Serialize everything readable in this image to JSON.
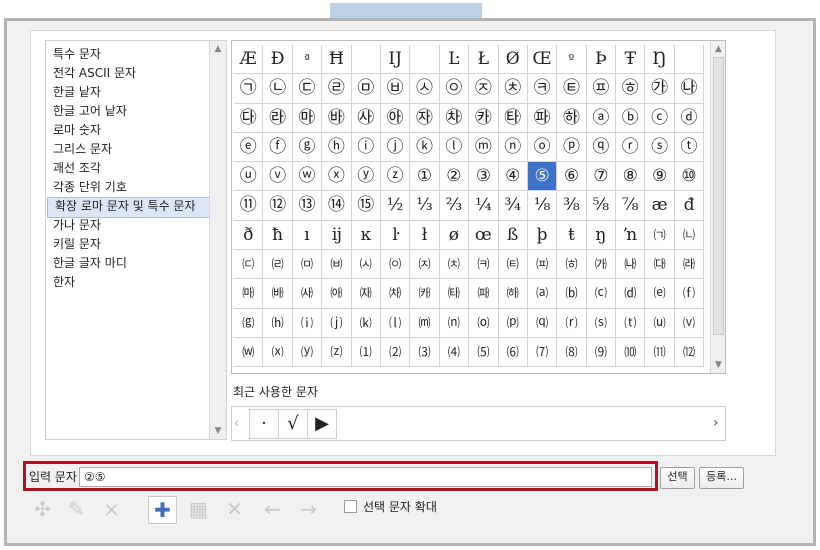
{
  "categories": [
    "특수 문자",
    "전각 ASCII 문자",
    "한글 낱자",
    "한글 고어 낱자",
    "로마 숫자",
    "그리스 문자",
    "괘선 조각",
    "각종 단위 기호",
    "확장 로마 문자 및 특수 문자",
    "가나 문자",
    "키릴 문자",
    "한글 글자 마디",
    "한자"
  ],
  "selected_category": "확장 로마 문자 및 특수 문자",
  "grid_rows": [
    [
      "Æ",
      "Ð",
      "ª",
      "Ħ",
      "",
      "Ĳ",
      "",
      "Ŀ",
      "Ł",
      "Ø",
      "Œ",
      "º",
      "Þ",
      "Ŧ",
      "Ŋ",
      ""
    ],
    [
      "㉠",
      "㉡",
      "㉢",
      "㉣",
      "㉤",
      "㉥",
      "㉦",
      "㉧",
      "㉨",
      "㉩",
      "㉪",
      "㉫",
      "㉬",
      "㉭",
      "㉮",
      "㉯"
    ],
    [
      "㉰",
      "㉱",
      "㉲",
      "㉳",
      "㉴",
      "㉵",
      "㉶",
      "㉷",
      "㉸",
      "㉹",
      "㉺",
      "㉻",
      "ⓐ",
      "ⓑ",
      "ⓒ",
      "ⓓ"
    ],
    [
      "ⓔ",
      "ⓕ",
      "ⓖ",
      "ⓗ",
      "ⓘ",
      "ⓙ",
      "ⓚ",
      "ⓛ",
      "ⓜ",
      "ⓝ",
      "ⓞ",
      "ⓟ",
      "ⓠ",
      "ⓡ",
      "ⓢ",
      "ⓣ"
    ],
    [
      "ⓤ",
      "ⓥ",
      "ⓦ",
      "ⓧ",
      "ⓨ",
      "ⓩ",
      "①",
      "②",
      "③",
      "④",
      "⑤",
      "⑥",
      "⑦",
      "⑧",
      "⑨",
      "⑩"
    ],
    [
      "⑪",
      "⑫",
      "⑬",
      "⑭",
      "⑮",
      "½",
      "⅓",
      "⅔",
      "¼",
      "¾",
      "⅛",
      "⅜",
      "⅝",
      "⅞",
      "æ",
      "đ"
    ],
    [
      "ð",
      "ħ",
      "ı",
      "ĳ",
      "ĸ",
      "ŀ",
      "ł",
      "ø",
      "œ",
      "ß",
      "þ",
      "ŧ",
      "ŋ",
      "ŉ",
      "㈀",
      "㈁"
    ],
    [
      "㈂",
      "㈃",
      "㈄",
      "㈅",
      "㈆",
      "㈇",
      "㈈",
      "㈉",
      "㈊",
      "㈋",
      "㈌",
      "㈍",
      "㈎",
      "㈏",
      "㈐",
      "㈑"
    ],
    [
      "㈒",
      "㈓",
      "㈔",
      "㈕",
      "㈖",
      "㈗",
      "㈘",
      "㈙",
      "㈚",
      "㈛",
      "⒜",
      "⒝",
      "⒞",
      "⒟",
      "⒠",
      "⒡"
    ],
    [
      "⒢",
      "⒣",
      "⒤",
      "⒥",
      "⒦",
      "⒧",
      "⒨",
      "⒩",
      "⒪",
      "⒫",
      "⒬",
      "⒭",
      "⒮",
      "⒯",
      "⒰",
      "⒱"
    ],
    [
      "⒲",
      "⒳",
      "⒴",
      "⒵",
      "⑴",
      "⑵",
      "⑶",
      "⑷",
      "⑸",
      "⑹",
      "⑺",
      "⑻",
      "⑼",
      "⑽",
      "⑾",
      "⑿"
    ]
  ],
  "selected_char": "⑤",
  "recent_label": "최근 사용한 문자",
  "recent_chars": [
    "·",
    "√",
    "▶"
  ],
  "input_label": "입력 문자",
  "input_value": "②⑤",
  "select_button": "선택",
  "register_button": "등록...",
  "zoom_label": "선택 문자 확대",
  "zoom_checked": false,
  "colors": {
    "selection": "#3e72c9",
    "highlight_border": "#b2121e",
    "top_tab": "#bcd3e6"
  }
}
